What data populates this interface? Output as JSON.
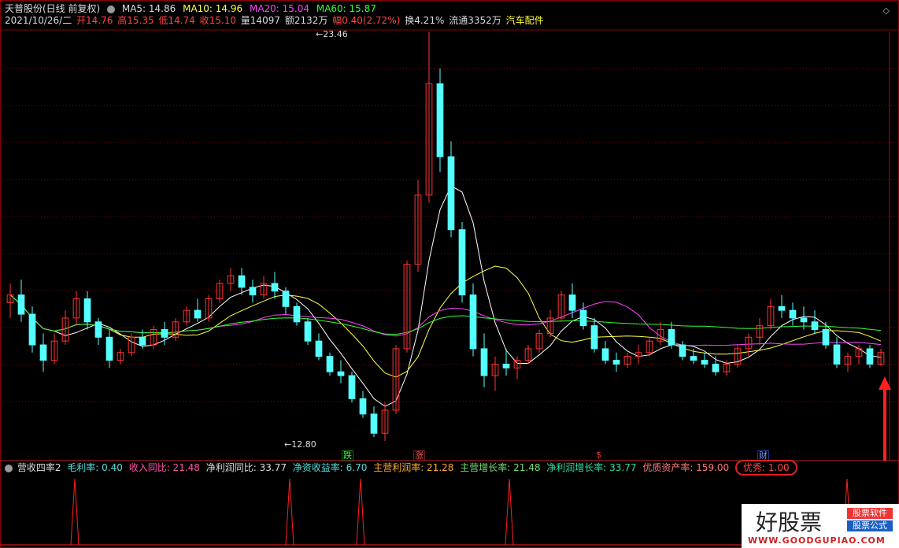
{
  "header": {
    "stock": "天普股份(日线 前复权)",
    "ma5": "MA5: 14.86",
    "ma10": "MA10: 14.96",
    "ma20": "MA20: 15.04",
    "ma60": "MA60: 15.87"
  },
  "quote": {
    "date": "2021/10/26/二",
    "open": "开14.76",
    "high": "高15.35",
    "low": "低14.74",
    "close": "收15.10",
    "volume": "量14097",
    "amount": "额2132万",
    "change": "幅0.40(2.72%)",
    "turnover": "换4.21%",
    "float": "流通3352万",
    "sector": "汽车配件"
  },
  "annotations": {
    "high_price": "23.46",
    "low_price": "12.80",
    "marker_die": "跌",
    "marker_zhang": "涨",
    "marker_s": "$",
    "marker_cai": "财"
  },
  "indicator": {
    "name": "营收四率2",
    "gross_margin": "毛利率: 0.40",
    "revenue_yoy": "收入同比: 21.48",
    "profit_yoy": "净利润同比: 33.77",
    "roe": "净资收益率: 6.70",
    "main_profit_rate": "主营利润率: 21.28",
    "main_growth": "主营增长率: 21.48",
    "net_growth": "净利润增长率: 33.77",
    "quality_asset": "优质资产率: 159.00",
    "excellent": "优秀: 1.00"
  },
  "watermark": {
    "title": "好股票",
    "url": "WWW.GOODGUPIAO.COM",
    "tag1": "股票软件",
    "tag2": "股票公式"
  },
  "colors": {
    "up": "#ff3333",
    "down": "#54ffff",
    "ma5": "#ffffff",
    "ma10": "#ffff44",
    "ma20": "#ff44ff",
    "ma60": "#33ff33",
    "grid": "#8b0000"
  },
  "chart_data": {
    "type": "candlestick",
    "price_range": [
      12.8,
      23.46
    ],
    "candles": [
      [
        16.4,
        16.9,
        16.0,
        16.6
      ],
      [
        16.6,
        17.0,
        15.9,
        16.1
      ],
      [
        16.1,
        16.3,
        15.1,
        15.3
      ],
      [
        15.3,
        15.6,
        14.6,
        14.9
      ],
      [
        14.9,
        15.6,
        14.8,
        15.4
      ],
      [
        15.4,
        16.2,
        15.3,
        16.0
      ],
      [
        16.0,
        16.7,
        15.8,
        16.5
      ],
      [
        16.5,
        16.7,
        15.7,
        15.9
      ],
      [
        15.9,
        16.0,
        15.3,
        15.5
      ],
      [
        15.5,
        15.7,
        14.7,
        14.9
      ],
      [
        14.9,
        15.2,
        14.8,
        15.1
      ],
      [
        15.1,
        15.6,
        15.0,
        15.5
      ],
      [
        15.5,
        15.7,
        15.2,
        15.3
      ],
      [
        15.3,
        15.8,
        15.2,
        15.7
      ],
      [
        15.7,
        15.9,
        15.3,
        15.5
      ],
      [
        15.5,
        16.0,
        15.4,
        15.9
      ],
      [
        15.9,
        16.3,
        15.8,
        16.2
      ],
      [
        16.2,
        16.5,
        15.9,
        16.0
      ],
      [
        16.0,
        16.6,
        15.9,
        16.5
      ],
      [
        16.5,
        17.0,
        16.4,
        16.9
      ],
      [
        16.9,
        17.3,
        16.7,
        17.1
      ],
      [
        17.1,
        17.3,
        16.6,
        16.8
      ],
      [
        16.8,
        17.0,
        16.4,
        16.6
      ],
      [
        16.6,
        17.1,
        16.5,
        16.9
      ],
      [
        16.9,
        17.2,
        16.5,
        16.7
      ],
      [
        16.7,
        16.8,
        16.1,
        16.3
      ],
      [
        16.3,
        16.4,
        15.8,
        15.9
      ],
      [
        15.9,
        16.0,
        15.3,
        15.4
      ],
      [
        15.4,
        15.6,
        14.9,
        15.0
      ],
      [
        15.0,
        15.1,
        14.5,
        14.6
      ],
      [
        14.6,
        14.9,
        14.3,
        14.5
      ],
      [
        14.5,
        14.6,
        13.8,
        13.9
      ],
      [
        13.9,
        14.1,
        13.4,
        13.5
      ],
      [
        13.5,
        13.7,
        12.9,
        13.0
      ],
      [
        13.0,
        13.8,
        12.8,
        13.6
      ],
      [
        13.6,
        15.3,
        13.5,
        15.2
      ],
      [
        15.2,
        17.5,
        15.1,
        17.4
      ],
      [
        17.4,
        19.6,
        17.2,
        19.2
      ],
      [
        19.2,
        23.46,
        19.0,
        22.1
      ],
      [
        22.1,
        22.5,
        19.8,
        20.2
      ],
      [
        20.2,
        20.6,
        18.1,
        18.3
      ],
      [
        18.3,
        18.5,
        16.4,
        16.6
      ],
      [
        16.6,
        16.9,
        15.0,
        15.2
      ],
      [
        15.2,
        15.6,
        14.2,
        14.5
      ],
      [
        14.5,
        15.0,
        14.1,
        14.8
      ],
      [
        14.8,
        15.2,
        14.5,
        14.7
      ],
      [
        14.7,
        15.0,
        14.4,
        14.9
      ],
      [
        14.9,
        15.3,
        14.8,
        15.2
      ],
      [
        15.2,
        15.7,
        15.1,
        15.6
      ],
      [
        15.6,
        16.2,
        15.5,
        16.0
      ],
      [
        16.0,
        16.7,
        15.9,
        16.6
      ],
      [
        16.6,
        16.9,
        16.0,
        16.2
      ],
      [
        16.2,
        16.4,
        15.7,
        15.8
      ],
      [
        15.8,
        16.0,
        15.1,
        15.2
      ],
      [
        15.2,
        15.4,
        14.8,
        14.9
      ],
      [
        14.9,
        15.1,
        14.6,
        14.8
      ],
      [
        14.8,
        15.1,
        14.7,
        15.0
      ],
      [
        15.0,
        15.3,
        14.8,
        15.1
      ],
      [
        15.1,
        15.5,
        15.0,
        15.4
      ],
      [
        15.4,
        15.9,
        15.3,
        15.7
      ],
      [
        15.7,
        15.9,
        15.2,
        15.3
      ],
      [
        15.3,
        15.4,
        14.9,
        15.0
      ],
      [
        15.0,
        15.2,
        14.8,
        14.9
      ],
      [
        14.9,
        15.1,
        14.7,
        14.8
      ],
      [
        14.8,
        15.0,
        14.5,
        14.6
      ],
      [
        14.6,
        14.9,
        14.5,
        14.8
      ],
      [
        14.8,
        15.3,
        14.7,
        15.2
      ],
      [
        15.2,
        15.6,
        15.0,
        15.5
      ],
      [
        15.5,
        16.0,
        15.3,
        15.8
      ],
      [
        15.8,
        16.5,
        15.7,
        16.3
      ],
      [
        16.3,
        16.6,
        16.0,
        16.2
      ],
      [
        16.2,
        16.4,
        15.8,
        16.0
      ],
      [
        16.0,
        16.3,
        15.7,
        15.9
      ],
      [
        15.9,
        16.2,
        15.6,
        15.7
      ],
      [
        15.7,
        15.9,
        15.2,
        15.3
      ],
      [
        15.3,
        15.5,
        14.7,
        14.8
      ],
      [
        14.8,
        15.1,
        14.6,
        15.0
      ],
      [
        15.0,
        15.3,
        14.8,
        15.2
      ],
      [
        15.2,
        15.3,
        14.7,
        14.8
      ],
      [
        14.8,
        15.2,
        14.74,
        15.1
      ]
    ]
  }
}
